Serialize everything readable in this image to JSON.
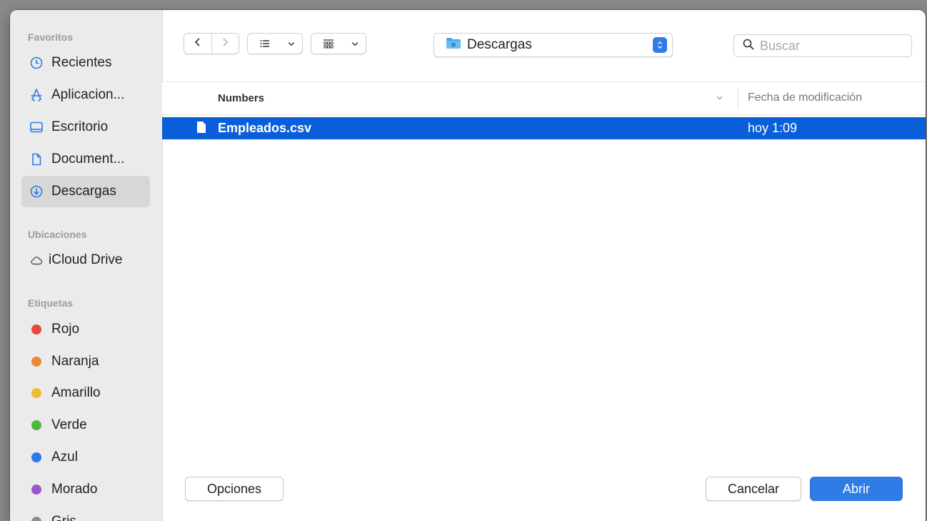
{
  "sidebar": {
    "favorites_title": "Favoritos",
    "favorites": [
      {
        "label": "Recientes",
        "icon": "clock-icon"
      },
      {
        "label": "Aplicacion...",
        "icon": "apps-icon"
      },
      {
        "label": "Escritorio",
        "icon": "desktop-icon"
      },
      {
        "label": "Document...",
        "icon": "document-icon"
      },
      {
        "label": "Descargas",
        "icon": "download-icon",
        "selected": true
      }
    ],
    "locations_title": "Ubicaciones",
    "locations": [
      {
        "label": "iCloud Drive",
        "icon": "cloud-icon"
      }
    ],
    "tags_title": "Etiquetas",
    "tags": [
      {
        "label": "Rojo",
        "color": "#e8473f"
      },
      {
        "label": "Naranja",
        "color": "#ea8a36"
      },
      {
        "label": "Amarillo",
        "color": "#ecbd33"
      },
      {
        "label": "Verde",
        "color": "#4fb63f"
      },
      {
        "label": "Azul",
        "color": "#2c78e6"
      },
      {
        "label": "Morado",
        "color": "#9b55c8"
      },
      {
        "label": "Gris",
        "color": "#8e8e8e"
      }
    ]
  },
  "toolbar": {
    "location": "Descargas",
    "search_placeholder": "Buscar"
  },
  "columns": {
    "name": "Numbers",
    "date": "Fecha de modificación"
  },
  "files": [
    {
      "name": "Empleados.csv",
      "date": "hoy 1:09",
      "selected": true
    }
  ],
  "footer": {
    "options": "Opciones",
    "cancel": "Cancelar",
    "open": "Abrir"
  },
  "colors": {
    "accent": "#2f7ce7",
    "selection": "#0a5fd8"
  }
}
